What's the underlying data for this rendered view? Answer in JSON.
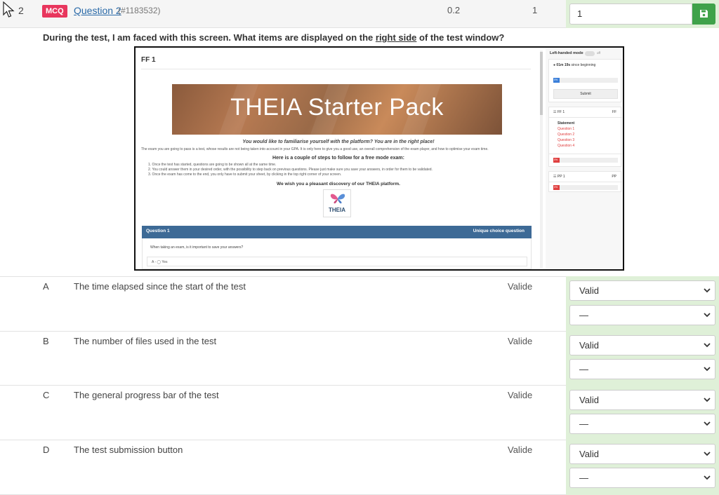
{
  "question": {
    "number": "2",
    "badge": "MCQ",
    "link_label": "Question 2",
    "id_text": "(#1183532)",
    "score": "0.2",
    "coefficient": "1",
    "input_value": "1",
    "text_before": "During the test, I am faced with this screen. What items are displayed on the ",
    "text_emphasis": "right side",
    "text_after": " of the test window?",
    "colors": {
      "badge": "#e8365d",
      "save": "#3fa24a",
      "answer_panel": "#dff0d8",
      "link": "#2a6aa8"
    }
  },
  "screenshot": {
    "title": "FF 1",
    "banner": "THEIA Starter Pack",
    "subtitle": "You would like to familiarise yourself with the platform? You are in the right place!",
    "intro": "The exam you are going to pass is a test, whose results are not being taken into account in your GPA. It is only here to give you a good use, an overall comprehension of the exam player, and how to optimise your exam time.",
    "steps_heading": "Here is a couple of steps to follow for a free mode exam:",
    "steps": [
      "1. Once the test has started, questions are going to be shown all at the same time.",
      "2. You could answer them in your desired order, with the possibility to step back on previous questions. Please just make sure you save your answers, in order for them to be validated.",
      "3. Once the exam has come to the end, you only have to submit your sheet, by clicking in the top right corner of your screen."
    ],
    "wish": "We wish you a pleasant discovery of our THEIA platform.",
    "logo_text": "THEIA",
    "q_header_left": "Question 1",
    "q_header_right": "Unique choice question",
    "q_prompt": "When taking an exam, is it important to save your answers?",
    "q_option": "A - ◯ Yes",
    "sidebar": {
      "left_handed": "Left-handed mode",
      "toggle_state": "off",
      "timer_value": "01m 19s",
      "timer_suffix": " since beginning",
      "progress_label": "0%",
      "submit": "Submit",
      "section1_name": "FF 1",
      "section1_code": "FF",
      "statement": "Statement",
      "questions": [
        "Question 1",
        "Question 2",
        "Question 3",
        "Question 4"
      ],
      "section1_progress": "0%",
      "section2_name": "PP 1",
      "section2_code": "PP",
      "section2_progress": "0%"
    }
  },
  "answers": [
    {
      "letter": "A",
      "text": "The time elapsed since the start of the test",
      "status": "Valide",
      "select1": "Valid",
      "select2": "—"
    },
    {
      "letter": "B",
      "text": "The number of files used in the test",
      "status": "Valide",
      "select1": "Valid",
      "select2": "—"
    },
    {
      "letter": "C",
      "text": "The general progress bar of the test",
      "status": "Valide",
      "select1": "Valid",
      "select2": "—"
    },
    {
      "letter": "D",
      "text": "The test submission button",
      "status": "Valide",
      "select1": "Valid",
      "select2": "—"
    }
  ]
}
